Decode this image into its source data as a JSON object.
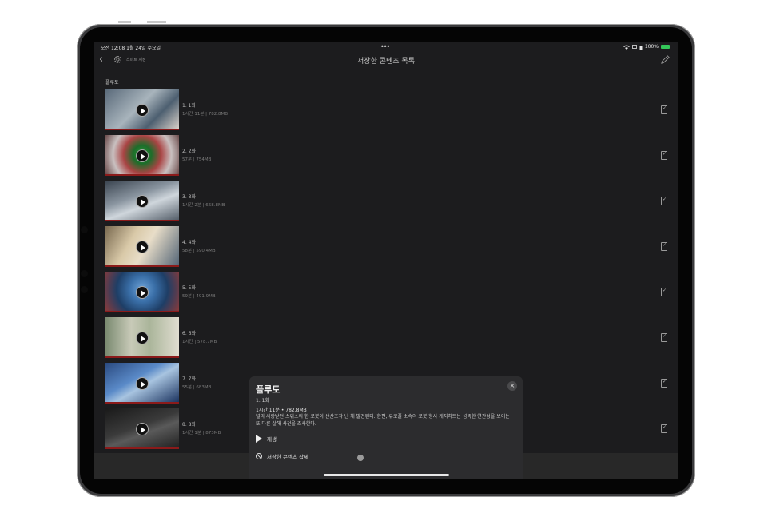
{
  "status_bar": {
    "time_date": "오전 12:08  1월 24일 수요일",
    "dots": "•••",
    "battery": "100%"
  },
  "nav": {
    "back": "‹",
    "gear_label": "스마트 저장",
    "title": "저장한 콘텐츠 목록"
  },
  "section_title": "플루토",
  "episodes": [
    {
      "title": "1. 1화",
      "meta": "1시간 11분 | 782.8MB"
    },
    {
      "title": "2. 2화",
      "meta": "57분 | 754MB"
    },
    {
      "title": "3. 3화",
      "meta": "1시간 2분 | 668.8MB"
    },
    {
      "title": "4. 4화",
      "meta": "58분 | 590.4MB"
    },
    {
      "title": "5. 5화",
      "meta": "59분 | 491.9MB"
    },
    {
      "title": "6. 6화",
      "meta": "1시간 | 578.7MB"
    },
    {
      "title": "7. 7화",
      "meta": "55분 | 683MB"
    },
    {
      "title": "8. 8화",
      "meta": "1시간 1분 | 873MB"
    }
  ],
  "sheet": {
    "title": "플루토",
    "episode": "1. 1화",
    "meta": "1시간 11분 • 782.8MB",
    "description": "널리 사랑받던 스위스의 한 로봇이 산산조각 난 채 발견된다. 한편, 유로폴 소속의 로봇 형사 게지히트는 섬뜩한 연관성을 보이는 또 다른 살해 사건을 조사한다.",
    "play_label": "재생",
    "delete_label": "저장한 콘텐츠 삭제",
    "close_label": "×"
  },
  "colors": {
    "background": "#1c1c1e",
    "sheet": "#2c2c2e",
    "accent_red": "#8b1a1a",
    "battery": "#34c759"
  },
  "icons": [
    "back-chevron-icon",
    "gear-icon",
    "pencil-icon",
    "play-icon",
    "downloaded-icon",
    "close-icon",
    "ban-icon"
  ]
}
